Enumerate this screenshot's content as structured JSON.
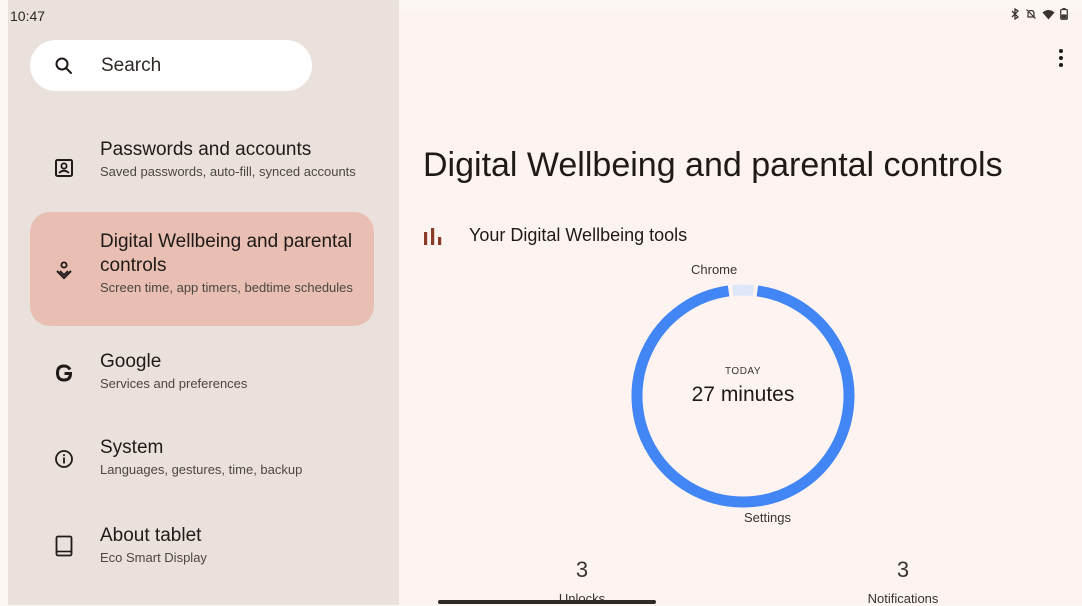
{
  "status_bar": {
    "time": "10:47"
  },
  "search": {
    "label": "Search"
  },
  "sidebar": {
    "items": [
      {
        "title": "Passwords and accounts",
        "subtitle": "Saved passwords, auto-fill, synced accounts"
      },
      {
        "title": "Digital Wellbeing and parental controls",
        "subtitle": "Screen time, app timers, bedtime schedules"
      },
      {
        "title": "Google",
        "subtitle": "Services and preferences"
      },
      {
        "title": "System",
        "subtitle": "Languages, gestures, time, backup"
      },
      {
        "title": "About tablet",
        "subtitle": "Eco Smart Display"
      }
    ]
  },
  "main": {
    "title": "Digital Wellbeing and parental controls",
    "tools_label": "Your Digital Wellbeing tools",
    "today_caption": "TODAY",
    "today_value": "27 minutes",
    "stats": [
      {
        "value": "3",
        "label": "Unlocks"
      },
      {
        "value": "3",
        "label": "Notifications"
      }
    ]
  },
  "chart_data": {
    "type": "pie",
    "style": "donut",
    "categories": [
      "Chrome",
      "Settings"
    ],
    "values": [
      1,
      26
    ],
    "colors": [
      "#dde7f8",
      "#4285f4"
    ]
  },
  "colors": {
    "accent": "#4285f4",
    "selected_item": "#e8bfb2",
    "sidebar_bg": "#ebe1dc",
    "content_bg": "#fdf4f1",
    "tools_icon": "#8d3b29"
  }
}
